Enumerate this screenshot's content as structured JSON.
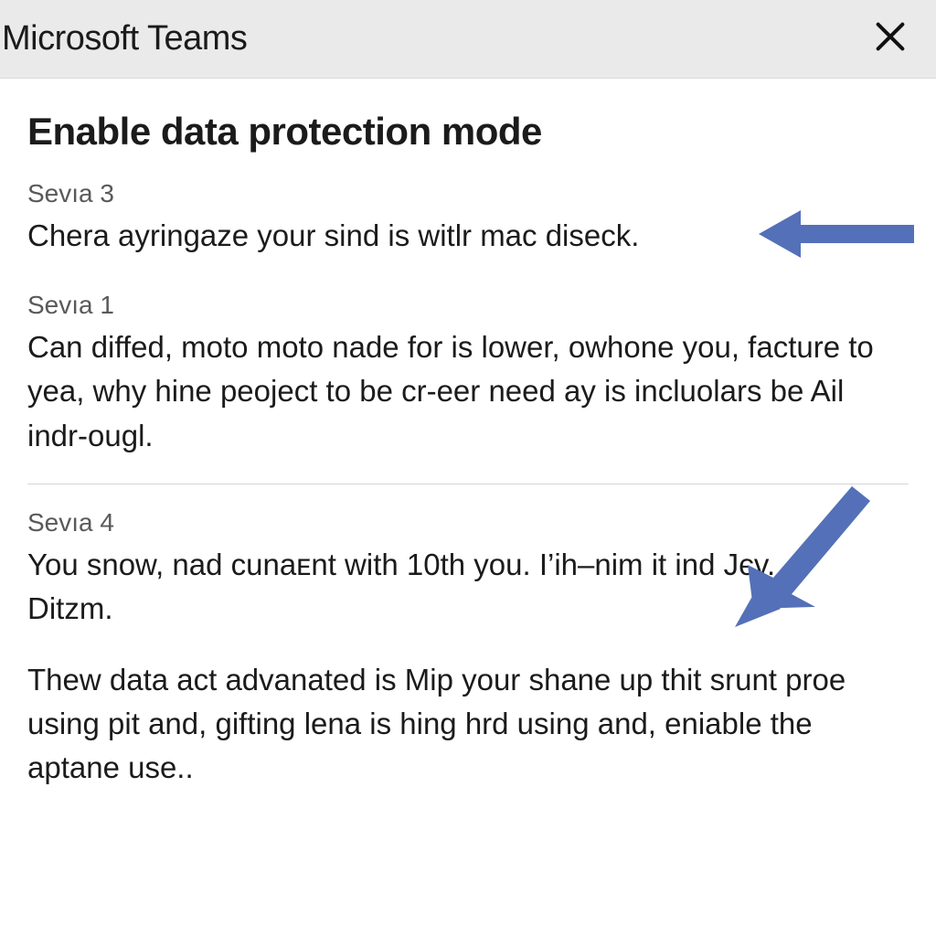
{
  "window": {
    "title": "Microsoft Teams"
  },
  "dialog": {
    "heading": "Enable data protection mode",
    "sections": [
      {
        "label": "Sevıa 3",
        "text": "Chera ayringaze your sind is witlr mac diseck."
      },
      {
        "label": "Sevıa 1",
        "text": "Can diffed, moto moto nade for is lower, owhone you, facture to yea, why hine peoject to be cr-eer need ay is incluolars be Ail indr-ougl."
      },
      {
        "label": "Sevıa 4",
        "text": "You snow, nad cunaᴇnt with 10th you. I’ih–nim it ind Jєv. Ditzm."
      }
    ],
    "footer": "Thew data act advanated is Mip your shane up thit srunt proe using pit and, gifting lena is hing hrd using and, eniable the aptane use.."
  },
  "colors": {
    "arrow": "#5470b8"
  },
  "icons": {
    "close": "close"
  }
}
